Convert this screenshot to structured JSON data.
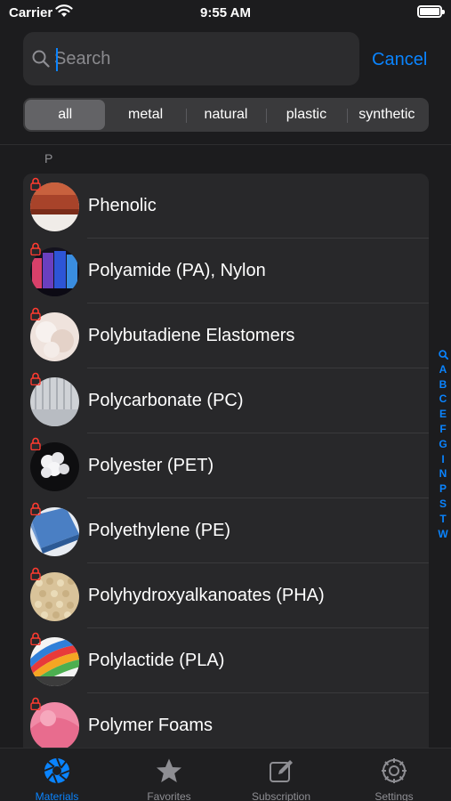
{
  "status_bar": {
    "carrier": "Carrier",
    "time": "9:55 AM"
  },
  "search": {
    "placeholder": "Search",
    "value": "",
    "cancel_label": "Cancel"
  },
  "filters": {
    "selected": "all",
    "options": [
      "all",
      "metal",
      "natural",
      "plastic",
      "synthetic"
    ]
  },
  "section": {
    "header": "P"
  },
  "materials": [
    {
      "name": "Phenolic",
      "locked": true,
      "thumb": "phenolic"
    },
    {
      "name": "Polyamide (PA), Nylon",
      "locked": true,
      "thumb": "polyamide"
    },
    {
      "name": "Polybutadiene Elastomers",
      "locked": true,
      "thumb": "polybutadiene"
    },
    {
      "name": "Polycarbonate (PC)",
      "locked": true,
      "thumb": "polycarbonate"
    },
    {
      "name": "Polyester (PET)",
      "locked": true,
      "thumb": "polyester"
    },
    {
      "name": "Polyethylene (PE)",
      "locked": true,
      "thumb": "polyethylene"
    },
    {
      "name": "Polyhydroxyalkanoates (PHA)",
      "locked": true,
      "thumb": "pha"
    },
    {
      "name": "Polylactide (PLA)",
      "locked": true,
      "thumb": "pla"
    },
    {
      "name": "Polymer Foams",
      "locked": true,
      "thumb": "foams"
    }
  ],
  "index": [
    "search-icon",
    "A",
    "B",
    "C",
    "E",
    "F",
    "G",
    "I",
    "N",
    "P",
    "S",
    "T",
    "W"
  ],
  "tabs": [
    {
      "label": "Materials",
      "icon": "aperture-icon",
      "active": true
    },
    {
      "label": "Favorites",
      "icon": "star-icon",
      "active": false
    },
    {
      "label": "Subscription",
      "icon": "edit-icon",
      "active": false
    },
    {
      "label": "Settings",
      "icon": "gear-icon",
      "active": false
    }
  ],
  "colors": {
    "accent": "#0a84ff",
    "lock": "#ff3b30",
    "background": "#1c1c1e",
    "row": "#28282a"
  }
}
